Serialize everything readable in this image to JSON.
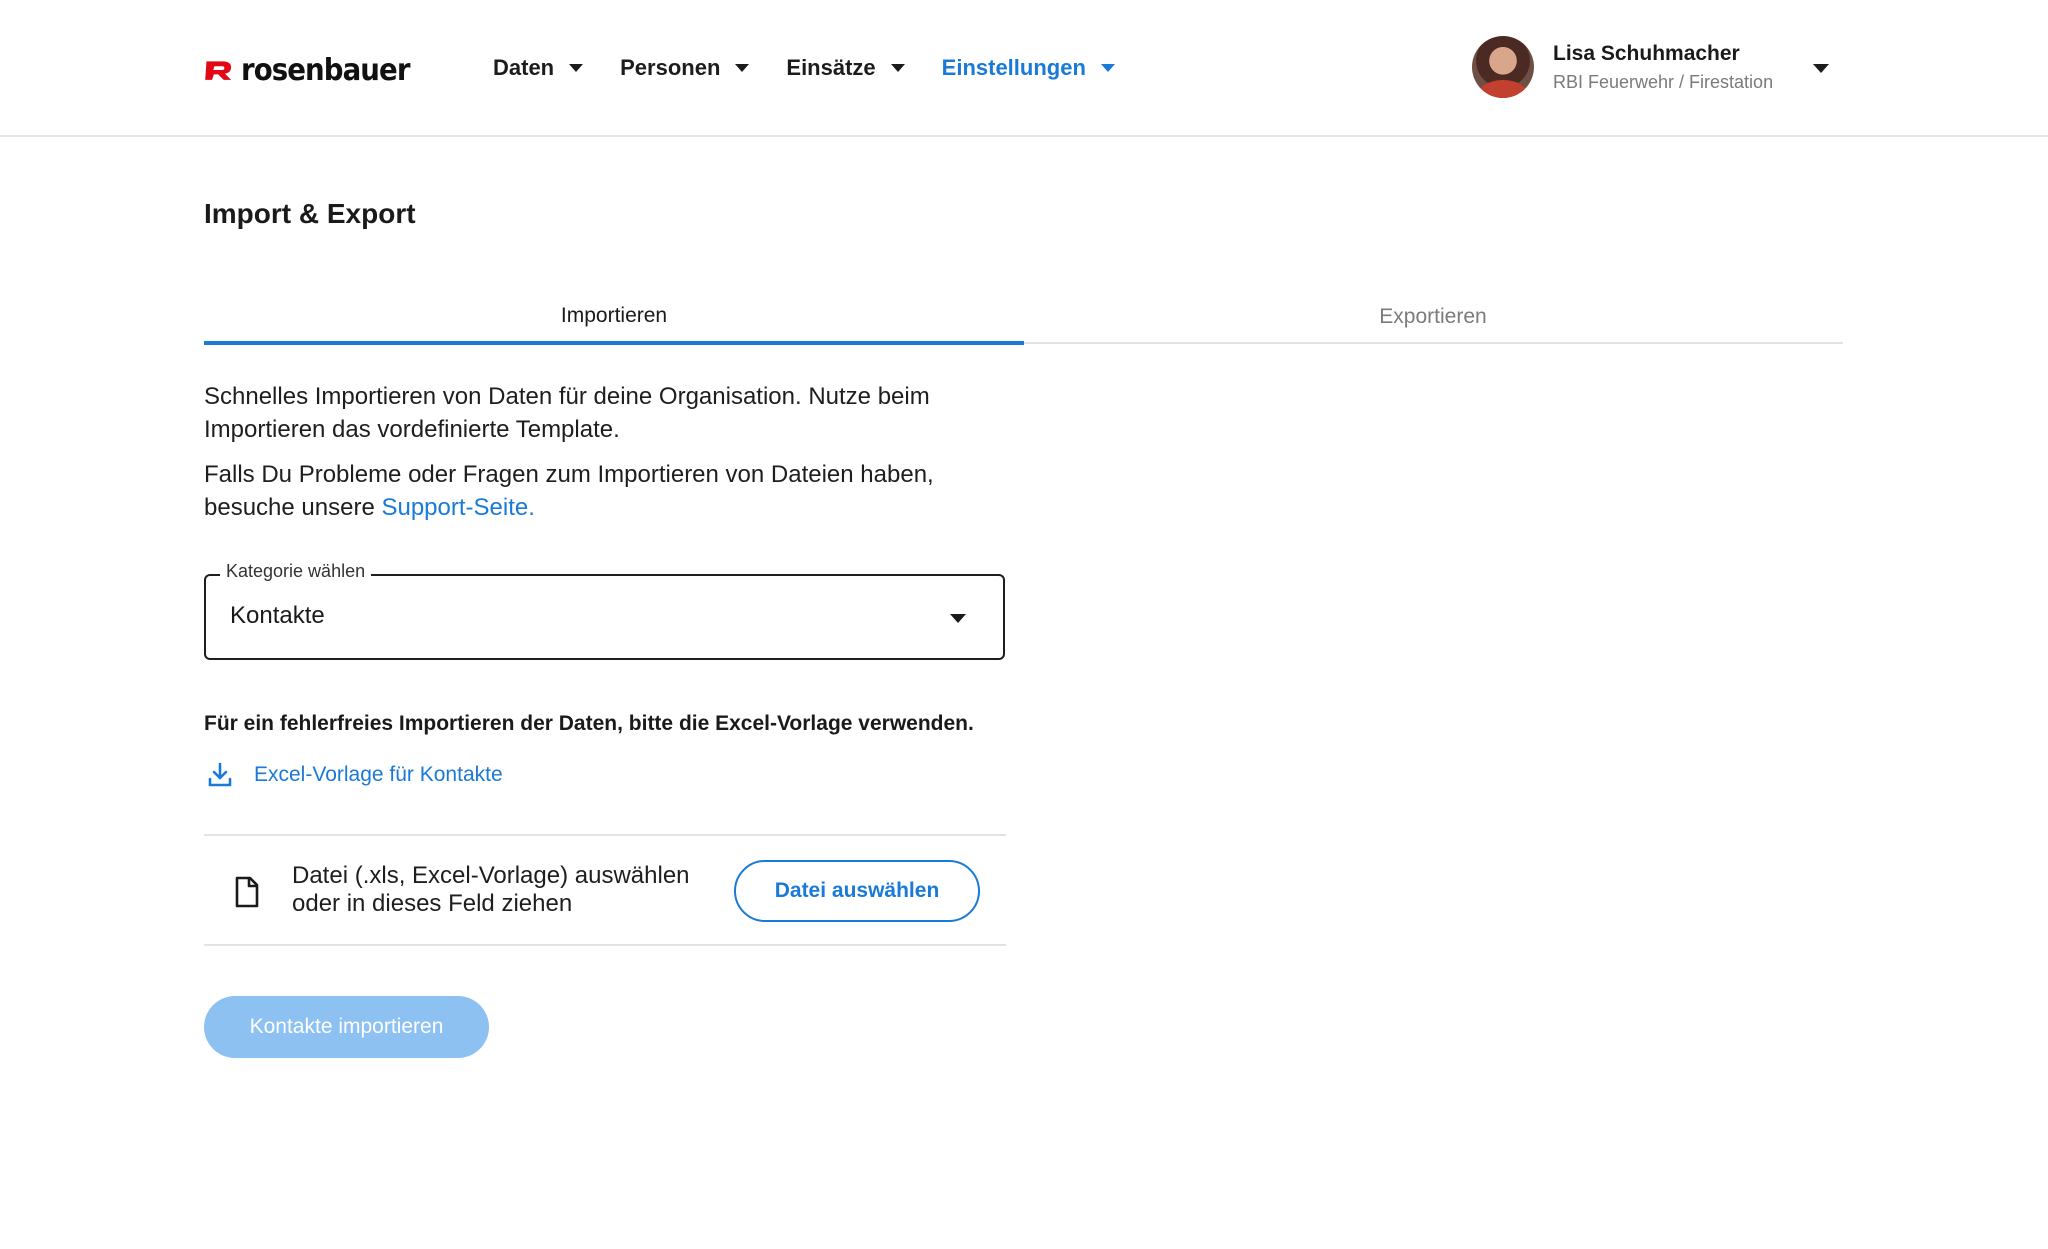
{
  "brand": {
    "logo_text": "rosenbauer",
    "accent_color": "#e30613"
  },
  "nav": {
    "items": [
      {
        "label": "Daten",
        "active": false
      },
      {
        "label": "Personen",
        "active": false
      },
      {
        "label": "Einsätze",
        "active": false
      },
      {
        "label": "Einstellungen",
        "active": true
      }
    ]
  },
  "user": {
    "name": "Lisa Schuhmacher",
    "organization": "RBI Feuerwehr / Firestation"
  },
  "page": {
    "title": "Import & Export",
    "tabs": [
      {
        "label": "Importieren",
        "active": true
      },
      {
        "label": "Exportieren",
        "active": false
      }
    ],
    "intro_line1": "Schnelles Importieren von Daten für deine Organisation. Nutze beim Importieren das vordefinierte Template.",
    "intro_line2_prefix": "Falls Du Probleme oder Fragen zum Importieren von Dateien haben, besuche unsere ",
    "intro_link": "Support-Seite.",
    "category": {
      "label": "Kategorie wählen",
      "value": "Kontakte"
    },
    "hint": "Für ein fehlerfreies Importieren der Daten, bitte die Excel-Vorlage verwenden.",
    "template_link": "Excel-Vorlage für Kontakte",
    "dropzone": {
      "text_line1": "Datei (.xls, Excel-Vorlage) auswählen",
      "text_line2": "oder in dieses Feld ziehen",
      "button": "Datei auswählen"
    },
    "import_button": "Kontakte importieren",
    "import_button_disabled": true
  },
  "colors": {
    "primary": "#1a7ad8",
    "primary_disabled": "#8cc1f2",
    "text": "#1a1a1a",
    "muted": "#7a7a7a"
  }
}
